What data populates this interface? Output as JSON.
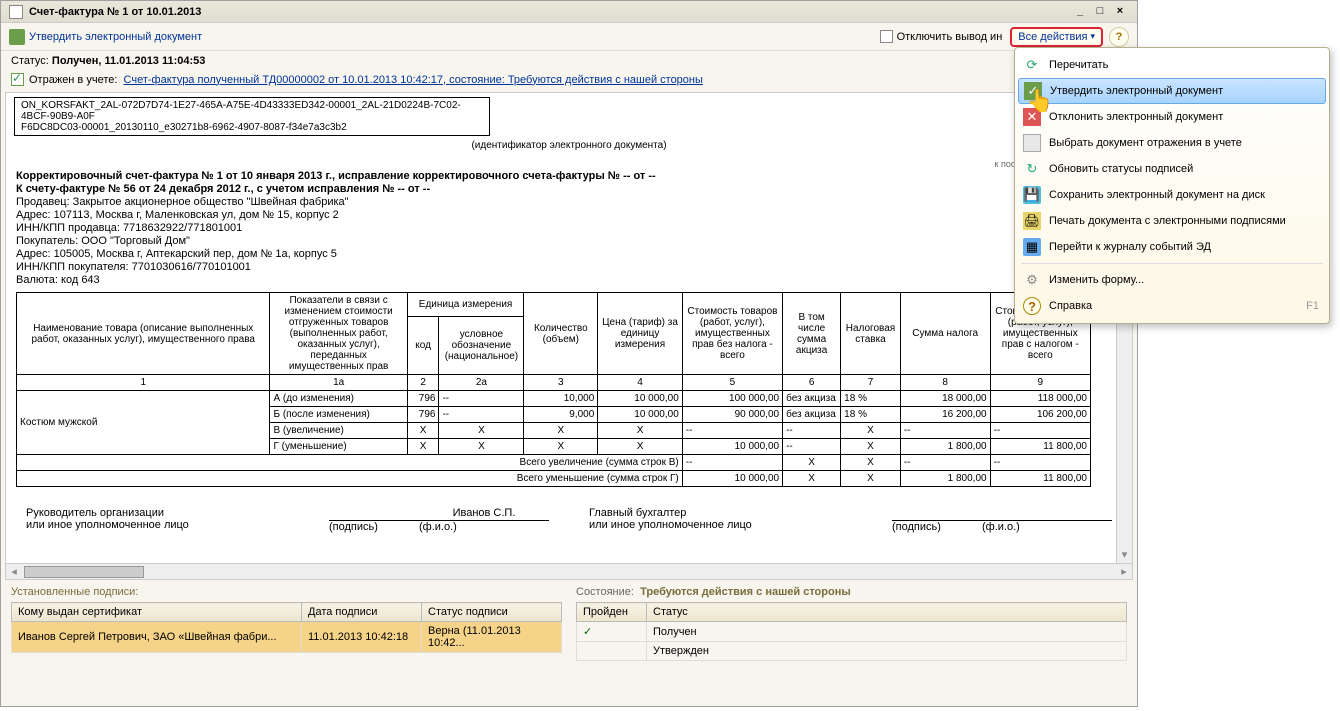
{
  "window": {
    "title": "Счет-фактура № 1 от 10.01.2013"
  },
  "toolbar": {
    "approve": "Утвердить электронный документ",
    "all_actions": "Все действия",
    "disable_info": "Отключить вывод ин"
  },
  "status": {
    "label": "Статус:",
    "value": "Получен, 11.01.2013 11:04:53"
  },
  "reflect": {
    "label": "Отражен в учете:",
    "link": "Счет-фактура полученный ТД00000002 от 10.01.2013 10:42:17, состояние: Требуются действия с нашей стороны"
  },
  "ident": {
    "line1": "ON_KORSFAKT_2AL-072D7D74-1E27-465A-A75E-4D43333ED342-00001_2AL-21D0224B-7C02-4BCF-90B9-A0F",
    "line2": "F6DC8DC03-00001_20130110_e30271b8-6962-4907-8087-f34e7a3c3b2",
    "caption": "(идентификатор электронного документа)"
  },
  "reg_note": "к постановлению Правительст",
  "doc": {
    "h1": "Корректировочный счет-фактура № 1 от 10 января 2013 г., исправление корректировочного счета-фактуры № -- от --",
    "h2": "К счету-фактуре № 56 от 24 декабря 2012 г., с учетом исправления № -- от --",
    "seller": "Продавец: Закрытое акционерное общество \"Швейная фабрика\"",
    "seller_addr": "Адрес: 107113, Москва г, Маленковская ул, дом № 15, корпус 2",
    "seller_inn": "ИНН/КПП продавца: 7718632922/771801001",
    "buyer": "Покупатель: ООО \"Торговый Дом\"",
    "buyer_addr": "Адрес: 105005, Москва г, Аптекарский пер, дом № 1а, корпус 5",
    "buyer_inn": "ИНН/КПП покупателя: 7701030616/770101001",
    "currency": "Валюта: код 643"
  },
  "headers": {
    "c1": "Наименование товара (описание выполненных работ, оказанных услуг), имущественного права",
    "c1a": "Показатели в связи с изменением стоимости отгруженных товаров (выполненных работ, оказанных услуг), переданных имущественных прав",
    "c2g": "Единица измерения",
    "c2code": "код",
    "c2name": "условное обозначение (национальное)",
    "c3": "Количество (объем)",
    "c4": "Цена (тариф) за единицу измерения",
    "c5": "Стоимость товаров (работ, услуг), имущественных прав без налога - всего",
    "c6": "В том числе сумма акциза",
    "c7": "Налоговая ставка",
    "c8": "Сумма налога",
    "c9": "Стоимость товаров (работ, услуг), имущественных прав с налогом - всего",
    "n1": "1",
    "n1a": "1а",
    "n2": "2",
    "n2a": "2а",
    "n3": "3",
    "n4": "4",
    "n5": "5",
    "n6": "6",
    "n7": "7",
    "n8": "8",
    "n9": "9"
  },
  "rows": {
    "item": "Костюм мужской",
    "a_lab": "А (до изменения)",
    "b_lab": "Б (после изменения)",
    "v_lab": "В (увеличение)",
    "g_lab": "Г (уменьшение)",
    "a": {
      "code": "796",
      "um": "--",
      "qty": "10,000",
      "price": "10 000,00",
      "sum": "100 000,00",
      "acc": "без акциза",
      "rate": "18 %",
      "tax": "18 000,00",
      "total": "118 000,00"
    },
    "b": {
      "code": "796",
      "um": "--",
      "qty": "9,000",
      "price": "10 000,00",
      "sum": "90 000,00",
      "acc": "без акциза",
      "rate": "18 %",
      "tax": "16 200,00",
      "total": "106 200,00"
    },
    "v": {
      "code": "Х",
      "um": "Х",
      "qty": "Х",
      "price": "Х",
      "sum": "--",
      "acc": "--",
      "rate": "Х",
      "tax": "--",
      "total": "--"
    },
    "g": {
      "code": "Х",
      "um": "Х",
      "qty": "Х",
      "price": "Х",
      "sum": "10 000,00",
      "acc": "--",
      "rate": "Х",
      "tax": "1 800,00",
      "total": "11 800,00"
    },
    "tot_v_lab": "Всего увеличение (сумма строк В)",
    "tot_v": {
      "sum": "--",
      "acc": "Х",
      "rate": "Х",
      "tax": "--",
      "total": "--"
    },
    "tot_g_lab": "Всего уменьшение (сумма строк Г)",
    "tot_g": {
      "sum": "10 000,00",
      "acc": "Х",
      "rate": "Х",
      "tax": "1 800,00",
      "total": "11 800,00"
    }
  },
  "sign": {
    "head": "Руководитель организации",
    "head2": "или иное уполномоченное лицо",
    "acc": "Главный бухгалтер",
    "acc2": "или иное уполномоченное лицо",
    "sp": "(подпись)",
    "fio": "(ф.и.о.)",
    "name": "Иванов С.П."
  },
  "sig_panel": {
    "title": "Установленные подписи:",
    "cols": {
      "who": "Кому выдан сертификат",
      "date": "Дата подписи",
      "status": "Статус подписи"
    },
    "row": {
      "who": "Иванов Сергей Петрович, ЗАО «Швейная фабри...",
      "date": "11.01.2013 10:42:18",
      "status": "Верна (11.01.2013 10:42..."
    }
  },
  "state_panel": {
    "label": "Состояние:",
    "value": "Требуются действия с нашей стороны",
    "cols": {
      "pass": "Пройден",
      "status": "Статус"
    },
    "r1": "Получен",
    "r2": "Утвержден"
  },
  "menu": {
    "reread": "Перечитать",
    "approve": "Утвердить электронный документ",
    "reject": "Отклонить электронный документ",
    "choose": "Выбрать документ отражения в учете",
    "refresh": "Обновить статусы подписей",
    "save": "Сохранить электронный документ на диск",
    "print": "Печать документа с электронными подписями",
    "journal": "Перейти к журналу событий ЭД",
    "form": "Изменить форму...",
    "help": "Справка",
    "f1": "F1"
  }
}
